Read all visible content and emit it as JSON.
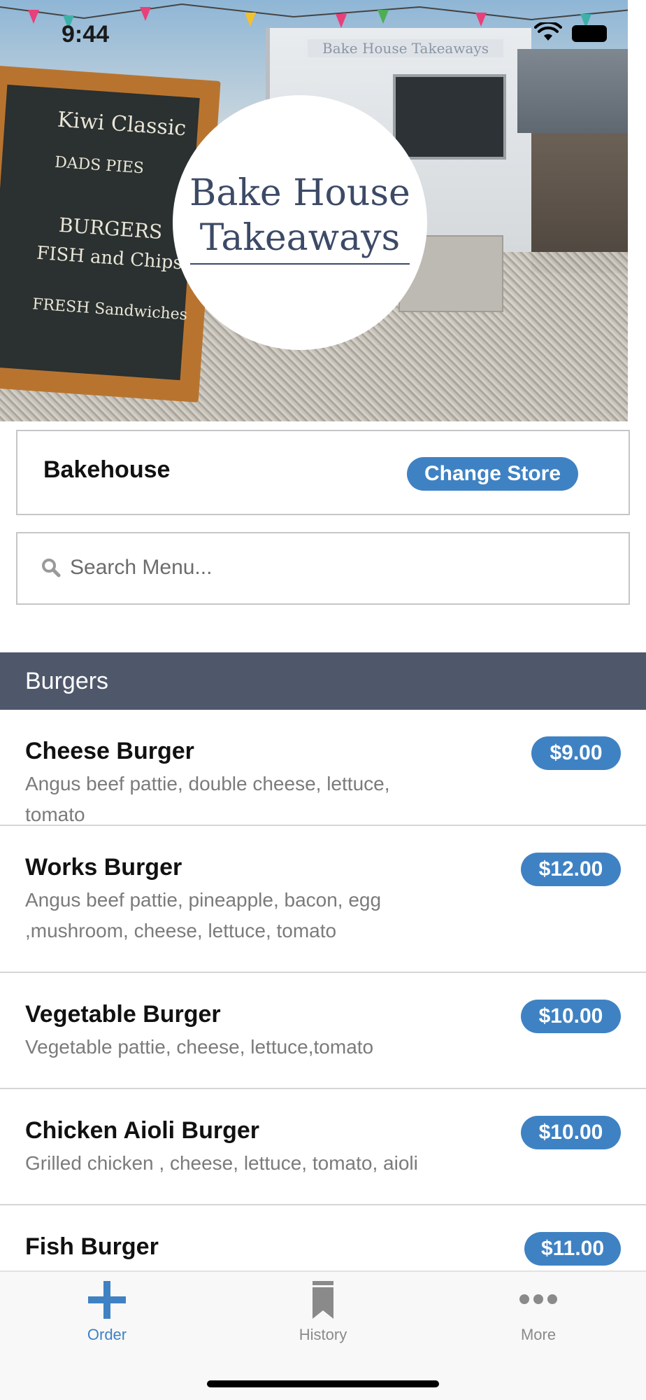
{
  "status_bar": {
    "time": "9:44"
  },
  "hero": {
    "logo_line1": "Bake House",
    "logo_line2": "Takeaways",
    "truck_sign": "Bake House Takeaways",
    "chalkboard_lines": [
      "Kiwi Classic",
      "DADS PIES",
      "BURGERS",
      "FISH and Chips",
      "FRESH Sandwiches"
    ]
  },
  "store": {
    "name": "Bakehouse",
    "change_label": "Change Store"
  },
  "search": {
    "placeholder": "Search Menu..."
  },
  "category": {
    "title": "Burgers"
  },
  "menu_items": [
    {
      "name": "Cheese Burger",
      "description": "Angus beef pattie, double cheese, lettuce, tomato",
      "price": "$9.00"
    },
    {
      "name": "Works Burger",
      "description": "Angus beef pattie, pineapple, bacon, egg ,mushroom, cheese, lettuce, tomato",
      "price": "$12.00"
    },
    {
      "name": "Vegetable Burger",
      "description": "Vegetable pattie, cheese, lettuce,tomato",
      "price": "$10.00"
    },
    {
      "name": "Chicken Aioli Burger",
      "description": "Grilled chicken , cheese, lettuce, tomato, aioli",
      "price": "$10.00"
    },
    {
      "name": "Fish Burger",
      "description": "",
      "price": "$11.00"
    }
  ],
  "tabs": [
    {
      "label": "Order",
      "icon": "plus-icon",
      "active": true
    },
    {
      "label": "History",
      "icon": "bookmark-icon",
      "active": false
    },
    {
      "label": "More",
      "icon": "ellipsis-icon",
      "active": false
    }
  ],
  "colors": {
    "accent": "#3f82c3",
    "category_bar": "#4f586b",
    "tab_active": "#3f82c3",
    "tab_inactive": "#8a8a8a",
    "logo_text": "#3c4a66"
  }
}
